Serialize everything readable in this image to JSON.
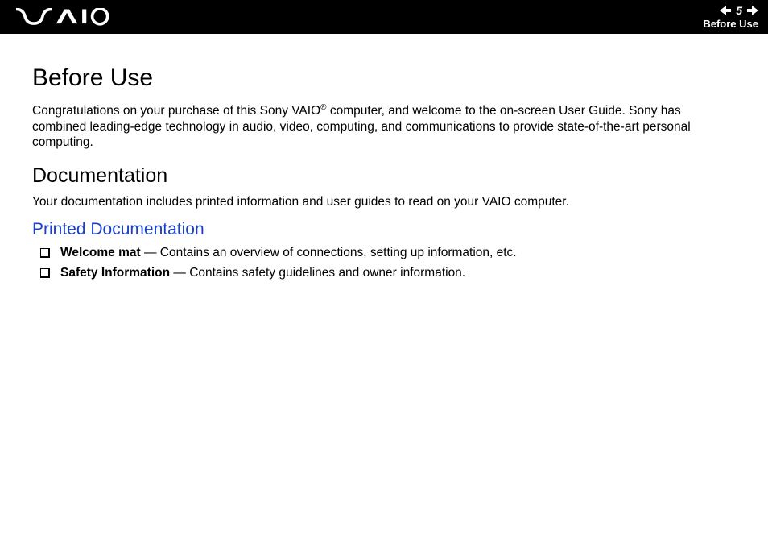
{
  "header": {
    "page_number": "5",
    "section_label": "Before Use"
  },
  "main": {
    "title": "Before Use",
    "intro_part1": "Congratulations on your purchase of this Sony VAIO",
    "intro_reg": "®",
    "intro_part2": " computer, and welcome to the on-screen User Guide. Sony has combined leading-edge technology in audio, video, computing, and communications to provide state-of-the-art personal computing.",
    "doc_heading": "Documentation",
    "doc_intro": "Your documentation includes printed information and user guides to read on your VAIO computer.",
    "printed_heading": "Printed Documentation",
    "bullets": [
      {
        "bold": "Welcome mat",
        "rest": " — Contains an overview of connections, setting up information, etc."
      },
      {
        "bold": "Safety Information",
        "rest": " — Contains safety guidelines and owner information."
      }
    ]
  }
}
